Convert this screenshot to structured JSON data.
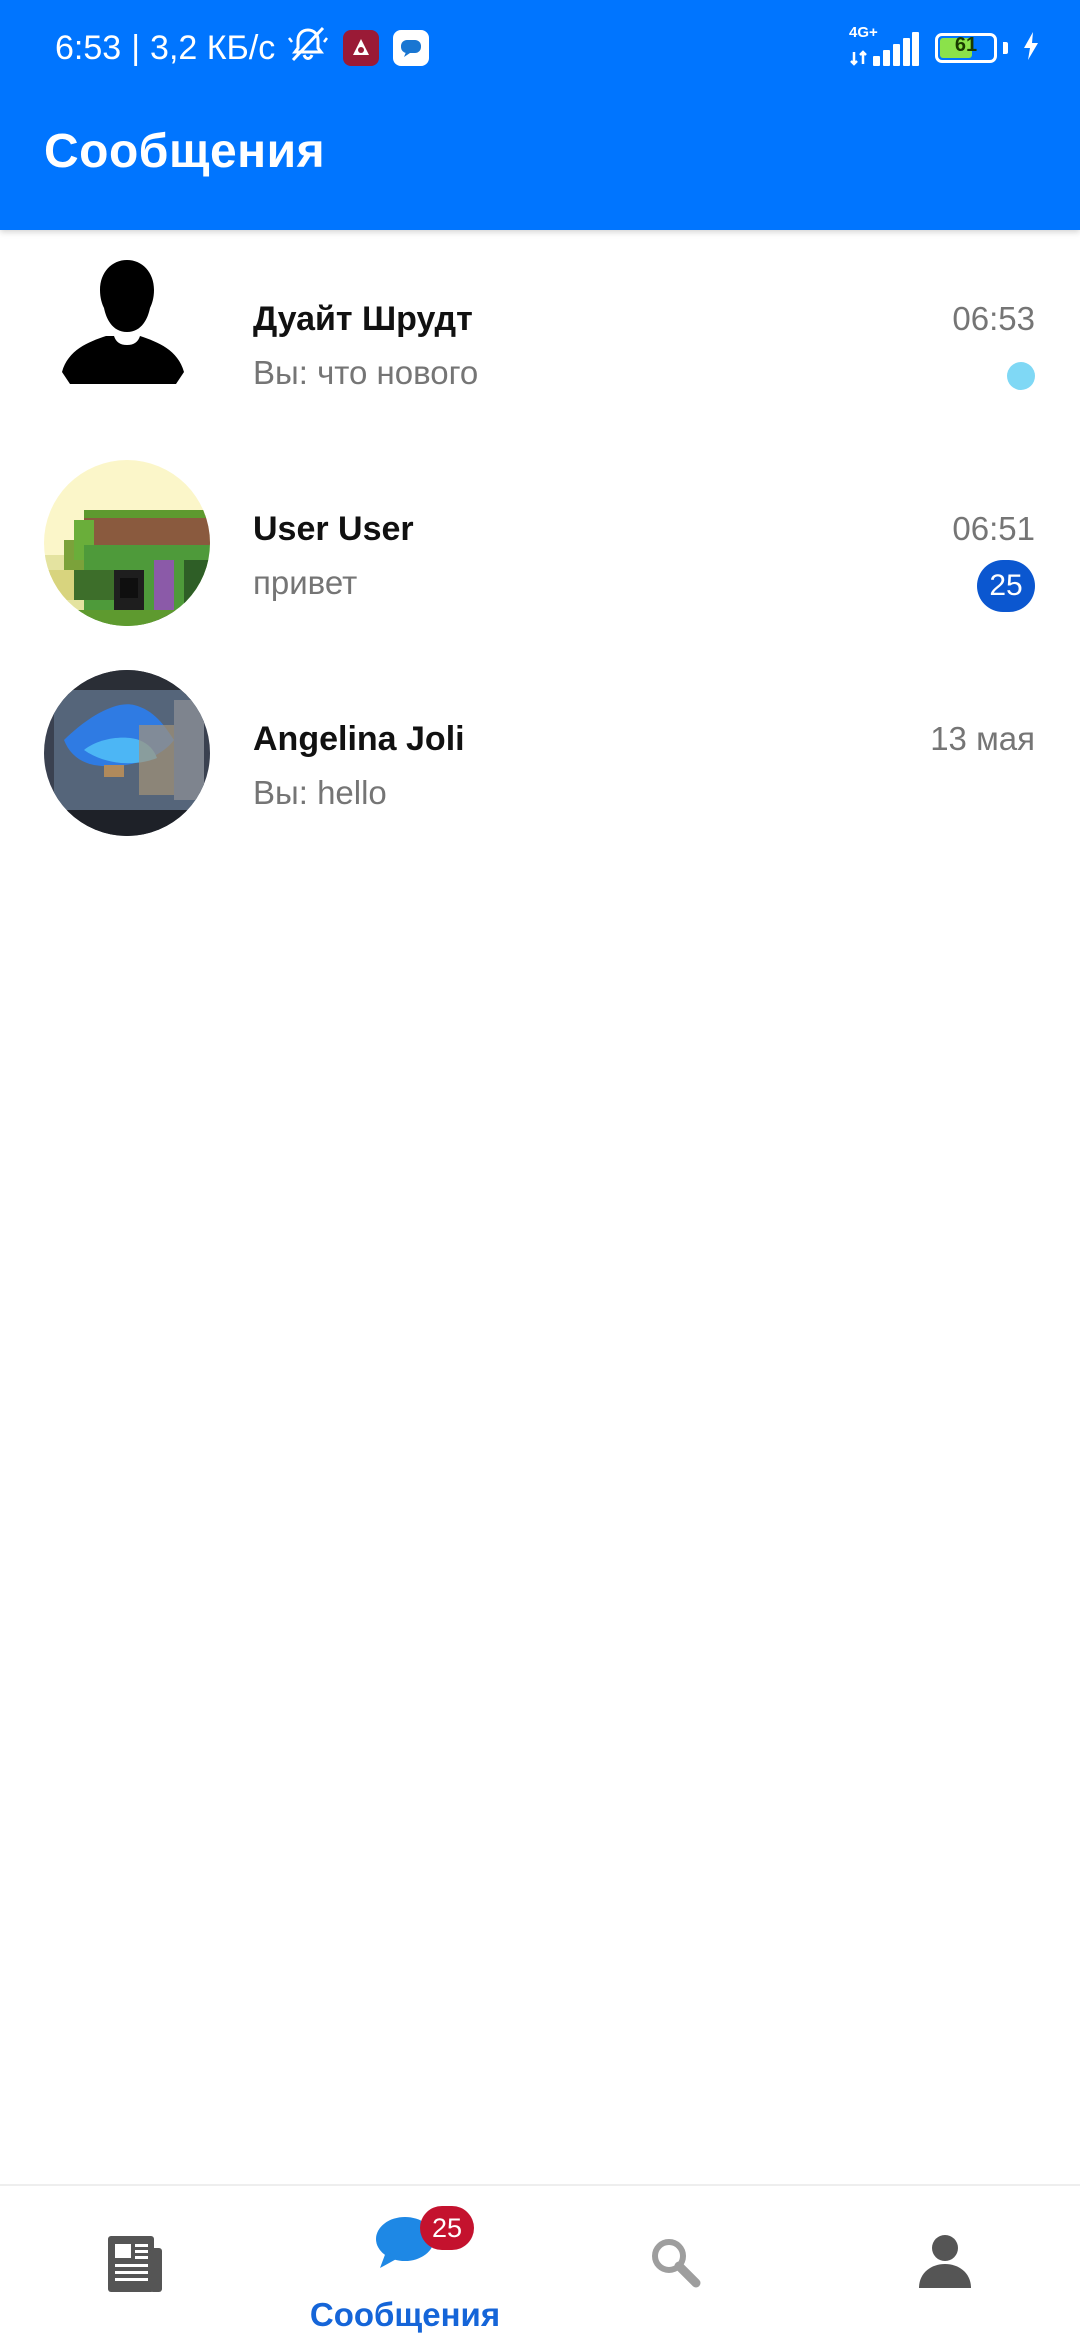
{
  "status_bar": {
    "time": "6:53",
    "separator": "|",
    "net_speed": "3,2 КБ/с",
    "network_type": "4G+",
    "battery_level": "61",
    "battery_fraction": 0.61
  },
  "app_bar": {
    "title": "Сообщения"
  },
  "chats": [
    {
      "name": "Дуайт Шрудт",
      "preview": "Вы: что нового",
      "time": "06:53",
      "indicator": "dot",
      "avatar_icon": "default-person-avatar"
    },
    {
      "name": "User User",
      "preview": "привет",
      "time": "06:51",
      "unread_count": "25",
      "avatar_icon": "pixel-art-avatar"
    },
    {
      "name": "Angelina Joli",
      "preview": "Вы: hello",
      "time": "13 мая",
      "avatar_icon": "photo-avatar"
    }
  ],
  "bottom_nav": {
    "items": [
      {
        "icon": "news-feed-icon"
      },
      {
        "icon": "chat-bubble-icon",
        "label": "Сообщения",
        "badge": "25",
        "active": true
      },
      {
        "icon": "search-icon"
      },
      {
        "icon": "profile-icon"
      }
    ]
  },
  "colors": {
    "primary": "#0075FF",
    "active_tab": "#1565D8",
    "unread_badge": "#0B57D0",
    "nav_badge": "#C4122E",
    "online_dot": "#7FD8F5",
    "secondary_text": "#757575"
  }
}
